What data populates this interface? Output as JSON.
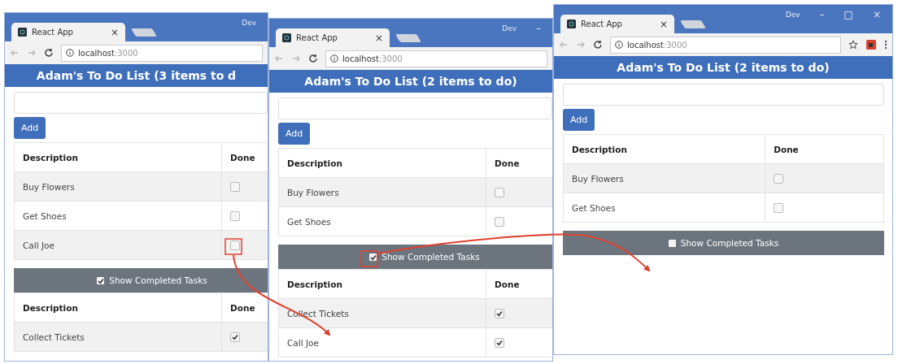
{
  "windows": [
    {
      "tab_title": "React App",
      "tab_close": "×",
      "caption": "Dev",
      "toolbar_icons": false,
      "url_host": "localhost",
      "url_port": ":3000",
      "heading": "Adam's To Do List (3 items to d",
      "add_button": "Add",
      "table": {
        "columns": [
          "Description",
          "Done"
        ],
        "rows": [
          {
            "description": "Buy Flowers",
            "done": false
          },
          {
            "description": "Get Shoes",
            "done": false
          },
          {
            "description": "Call Joe",
            "done": false
          }
        ]
      },
      "toggle": {
        "label": "Show Completed Tasks",
        "checked": true
      },
      "completed_table": {
        "columns": [
          "Description",
          "Done"
        ],
        "rows": [
          {
            "description": "Collect Tickets",
            "done": true
          }
        ]
      }
    },
    {
      "tab_title": "React App",
      "tab_close": "×",
      "caption": "Dev",
      "window_controls": [
        "–"
      ],
      "toolbar_icons": false,
      "url_host": "localhost",
      "url_port": ":3000",
      "heading": "Adam's To Do List (2 items to do)",
      "add_button": "Add",
      "table": {
        "columns": [
          "Description",
          "Done"
        ],
        "rows": [
          {
            "description": "Buy Flowers",
            "done": false
          },
          {
            "description": "Get Shoes",
            "done": false
          }
        ]
      },
      "toggle": {
        "label": "Show Completed Tasks",
        "checked": true
      },
      "completed_table": {
        "columns": [
          "Description",
          "Done"
        ],
        "rows": [
          {
            "description": "Collect Tickets",
            "done": true
          },
          {
            "description": "Call Joe",
            "done": true
          }
        ]
      }
    },
    {
      "tab_title": "React App",
      "tab_close": "×",
      "caption": "Dev",
      "window_controls": [
        "–",
        "□",
        "×"
      ],
      "toolbar_icons": true,
      "url_host": "localhost",
      "url_port": ":3000",
      "heading": "Adam's To Do List (2 items to do)",
      "add_button": "Add",
      "table": {
        "columns": [
          "Description",
          "Done"
        ],
        "rows": [
          {
            "description": "Buy Flowers",
            "done": false
          },
          {
            "description": "Get Shoes",
            "done": false
          }
        ]
      },
      "toggle": {
        "label": "Show Completed Tasks",
        "checked": false
      }
    }
  ]
}
